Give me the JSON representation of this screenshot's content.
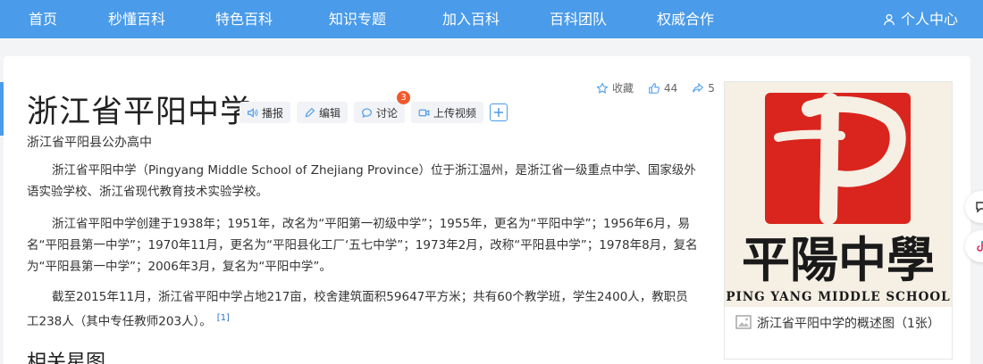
{
  "nav": {
    "items": [
      "首页",
      "秒懂百科",
      "特色百科",
      "知识专题",
      "加入百科",
      "百科团队",
      "权威合作"
    ],
    "user_center": "个人中心"
  },
  "entry": {
    "title": "浙江省平阳中学",
    "subtitle": "浙江省平阳县公办高中",
    "actions": {
      "play": "播报",
      "edit": "编辑",
      "discuss": "讨论",
      "discuss_count": "3",
      "upload_video": "上传视频"
    },
    "meta": {
      "favorite": "收藏",
      "likes": "44",
      "shares": "5"
    },
    "paragraphs": [
      "浙江省平阳中学（Pingyang Middle School of Zhejiang Province）位于浙江温州，是浙江省一级重点中学、国家级外语实验学校、浙江省现代教育技术实验学校。",
      "浙江省平阳中学创建于1938年；1951年，改名为“平阳第一初级中学”；1955年，更名为“平阳中学”；1956年6月，易名“平阳县第一中学”；1970年11月，更名为“平阳县化工厂‘五七中学”；1973年2月，改称“平阳县中学”；1978年8月，复名为“平阳县第一中学”；2006年3月，复名为“平阳中学”。",
      "截至2015年11月，浙江省平阳中学占地217亩，校舍建筑面积59647平方米；共有60个教学班，学生2400人，教职员工238人（其中专任教师203人）。"
    ],
    "reference": "[1]",
    "section_title": "相关星图"
  },
  "summary_image": {
    "logo_chars": "平陽中學",
    "logo_english": "PING YANG MIDDLE SCHOOL",
    "caption": "浙江省平阳中学的概述图（1张）"
  },
  "colors": {
    "nav_bg": "#4a9be9",
    "badge": "#f2592b",
    "logo_red": "#d9251d",
    "accent_blue": "#4a9be9"
  },
  "icons": [
    "user-icon",
    "speaker-icon",
    "pencil-icon",
    "chat-icon",
    "video-icon",
    "plus-icon",
    "star-icon",
    "thumbs-up-icon",
    "share-icon",
    "image-icon"
  ]
}
